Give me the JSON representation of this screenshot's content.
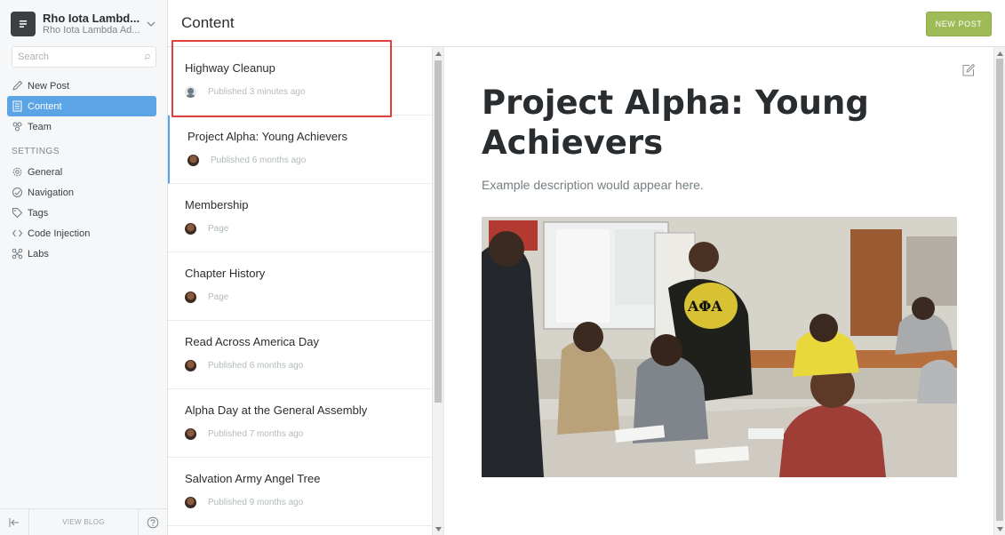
{
  "sidebar": {
    "blog_title": "Rho Iota Lambd...",
    "blog_subtitle": "Rho Iota Lambda Ad...",
    "search_placeholder": "Search",
    "nav": [
      {
        "label": "New Post",
        "icon": "pencil-icon"
      },
      {
        "label": "Content",
        "icon": "document-icon"
      },
      {
        "label": "Team",
        "icon": "team-icon"
      }
    ],
    "settings_label": "SETTINGS",
    "settings": [
      {
        "label": "General",
        "icon": "gear-icon"
      },
      {
        "label": "Navigation",
        "icon": "compass-icon"
      },
      {
        "label": "Tags",
        "icon": "tag-icon"
      },
      {
        "label": "Code Injection",
        "icon": "code-icon"
      },
      {
        "label": "Labs",
        "icon": "labs-icon"
      }
    ],
    "footer": {
      "view_blog": "VIEW BLOG"
    }
  },
  "header": {
    "title": "Content",
    "new_post_label": "NEW POST"
  },
  "posts": [
    {
      "title": "Highway Cleanup",
      "status": "Published 3 minutes ago",
      "avatar": "default-avatar"
    },
    {
      "title": "Project Alpha: Young Achievers",
      "status": "Published 6 months ago",
      "avatar": "user-avatar"
    },
    {
      "title": "Membership",
      "status": "Page",
      "avatar": "user-avatar"
    },
    {
      "title": "Chapter History",
      "status": "Page",
      "avatar": "user-avatar"
    },
    {
      "title": "Read Across America Day",
      "status": "Published 6 months ago",
      "avatar": "user-avatar"
    },
    {
      "title": "Alpha Day at the General Assembly",
      "status": "Published 7 months ago",
      "avatar": "user-avatar"
    },
    {
      "title": "Salvation Army Angel Tree",
      "status": "Published 9 months ago",
      "avatar": "user-avatar"
    }
  ],
  "preview": {
    "title": "Project Alpha: Young Achievers",
    "description": "Example description would appear here.",
    "image_shirt_text": "ΑΦΑ"
  },
  "colors": {
    "accent": "#5ba4e5",
    "new_post_button": "#9fbb58",
    "highlight": "#e0413f"
  }
}
